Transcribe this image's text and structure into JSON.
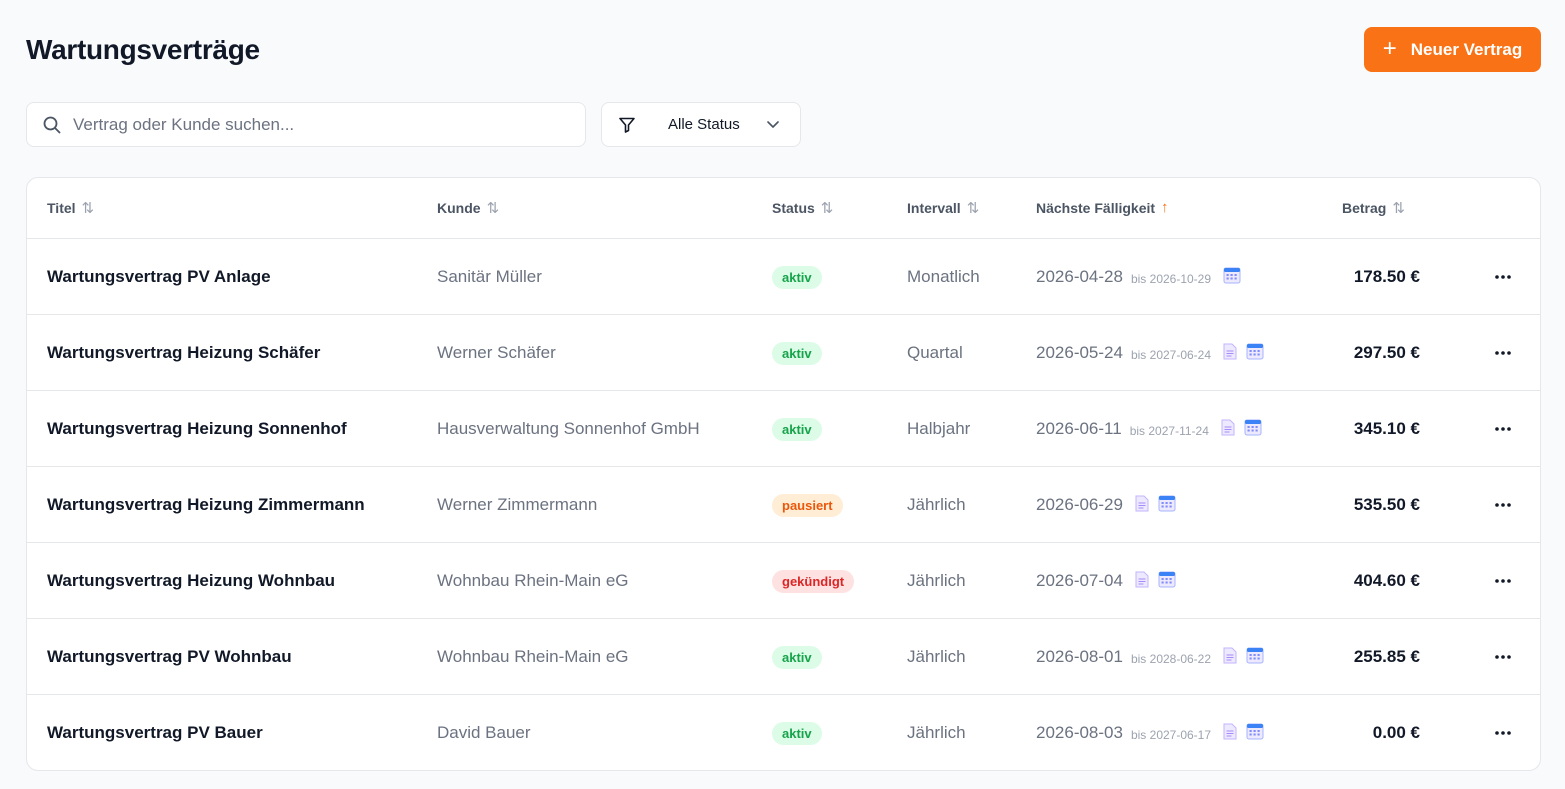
{
  "page": {
    "title": "Wartungsverträge",
    "new_button_label": "Neuer Vertrag"
  },
  "filters": {
    "search_placeholder": "Vertrag oder Kunde suchen...",
    "search_value": "",
    "status_selected": "Alle Status"
  },
  "table": {
    "columns": {
      "title": "Titel",
      "customer": "Kunde",
      "status": "Status",
      "interval": "Intervall",
      "due": "Nächste Fälligkeit",
      "amount": "Betrag"
    },
    "sorted_column": "due",
    "sort_direction": "ascending",
    "rows": [
      {
        "title": "Wartungsvertrag PV Anlage",
        "customer": "Sanitär Müller",
        "status": "aktiv",
        "status_kind": "aktiv",
        "interval": "Monatlich",
        "due": "2026-04-28",
        "until": "bis 2026-10-29",
        "has_doc": false,
        "amount": "178.50 €"
      },
      {
        "title": "Wartungsvertrag Heizung Schäfer",
        "customer": "Werner Schäfer",
        "status": "aktiv",
        "status_kind": "aktiv",
        "interval": "Quartal",
        "due": "2026-05-24",
        "until": "bis 2027-06-24",
        "has_doc": true,
        "amount": "297.50 €"
      },
      {
        "title": "Wartungsvertrag Heizung Sonnenhof",
        "customer": "Hausverwaltung Sonnenhof GmbH",
        "status": "aktiv",
        "status_kind": "aktiv",
        "interval": "Halbjahr",
        "due": "2026-06-11",
        "until": "bis 2027-11-24",
        "has_doc": true,
        "amount": "345.10 €"
      },
      {
        "title": "Wartungsvertrag Heizung Zimmermann",
        "customer": "Werner Zimmermann",
        "status": "pausiert",
        "status_kind": "pausiert",
        "interval": "Jährlich",
        "due": "2026-06-29",
        "until": "",
        "has_doc": true,
        "amount": "535.50 €"
      },
      {
        "title": "Wartungsvertrag Heizung Wohnbau",
        "customer": "Wohnbau Rhein-Main eG",
        "status": "gekündigt",
        "status_kind": "gekuendigt",
        "interval": "Jährlich",
        "due": "2026-07-04",
        "until": "",
        "has_doc": true,
        "amount": "404.60 €"
      },
      {
        "title": "Wartungsvertrag PV Wohnbau",
        "customer": "Wohnbau Rhein-Main eG",
        "status": "aktiv",
        "status_kind": "aktiv",
        "interval": "Jährlich",
        "due": "2026-08-01",
        "until": "bis 2028-06-22",
        "has_doc": true,
        "amount": "255.85 €"
      },
      {
        "title": "Wartungsvertrag PV Bauer",
        "customer": "David Bauer",
        "status": "aktiv",
        "status_kind": "aktiv",
        "interval": "Jährlich",
        "due": "2026-08-03",
        "until": "bis 2027-06-17",
        "has_doc": true,
        "amount": "0.00 €"
      }
    ]
  },
  "colors": {
    "accent": "#f97316",
    "status_aktiv": "#16a34a",
    "status_pausiert": "#ea580c",
    "status_gekuendigt": "#dc2626"
  },
  "icons": {
    "search": "search-icon",
    "filter": "filter-icon",
    "dropdown": "chevron-down-icon",
    "sort": "sort-icon",
    "sort_active": "arrow-up-icon",
    "document": "document-icon",
    "calendar": "calendar-icon",
    "row_menu": "more-horizontal-icon",
    "add": "plus-icon"
  }
}
